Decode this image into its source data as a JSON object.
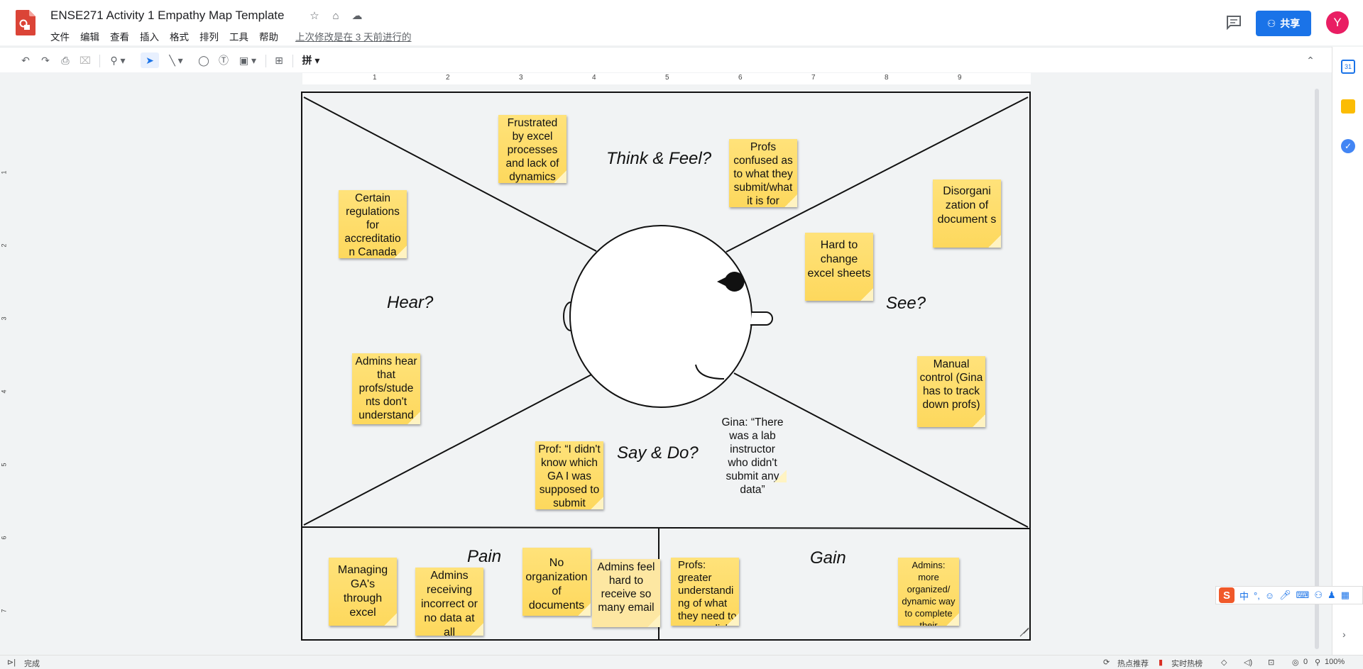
{
  "app": {
    "title": "ENSE271 Activity 1 Empathy Map Template",
    "last_edit": "上次修改是在 3 天前进行的",
    "share_label": "共享",
    "avatar_letter": "Y",
    "brand_color": "#1a73e8"
  },
  "menu": [
    "文件",
    "编辑",
    "查看",
    "插入",
    "格式",
    "排列",
    "工具",
    "帮助"
  ],
  "toolbar": {
    "undo": "undo-icon",
    "redo": "redo-icon",
    "print": "print-icon",
    "paint_format": "paint-format-icon",
    "zoom": "zoom-icon",
    "select": "select-arrow-icon",
    "line": "line-icon",
    "shape": "shape-icon",
    "textbox": "text-box-icon",
    "image": "image-icon",
    "comment": "add-comment-icon",
    "input_method": "拼"
  },
  "ruler": {
    "h_numbers": [
      "1",
      "2",
      "3",
      "4",
      "5",
      "6",
      "7",
      "8",
      "9"
    ],
    "v_numbers": [
      "1",
      "2",
      "3",
      "4",
      "5",
      "6",
      "7"
    ]
  },
  "map": {
    "quadrants": {
      "think_feel": "Think & Feel?",
      "hear": "Hear?",
      "see": "See?",
      "say_do": "Say & Do?",
      "pain": "Pain",
      "gain": "Gain"
    },
    "notes": {
      "frustrated": "Frustrated by excel processes and lack of dynamics",
      "profs_confused": "Profs confused as to what they submit/what it is for",
      "regulations": "Certain regulations for accreditatio n Canada",
      "disorganization": "Disorgani zation of document s",
      "hard_change": "Hard to change excel sheets",
      "admins_hear": "Admins hear that profs/stude nts don't understand processes",
      "manual_control": "Manual control (Gina has to track down profs)",
      "gina": "Gina: “There was a lab instructor who didn't submit any data”",
      "prof_quote": "Prof: “I didn't know which GA I was supposed to submit",
      "managing_ga": "Managing GA's through excel",
      "admins_receiving": "Admins receiving incorrect or no data at all",
      "no_organization": "No organization of documents",
      "admins_feel": "Admins feel hard to receive so many email",
      "profs_gain": "Profs: greater understandi ng of what they need to accomplish",
      "admins_gain": "Admins: more organized/ dynamic way to complete their processes"
    }
  },
  "statusbar": {
    "left": "完成",
    "hot1": "热点推荐",
    "hot2": "实时热榜",
    "zero": "0",
    "zoom": "100%"
  }
}
